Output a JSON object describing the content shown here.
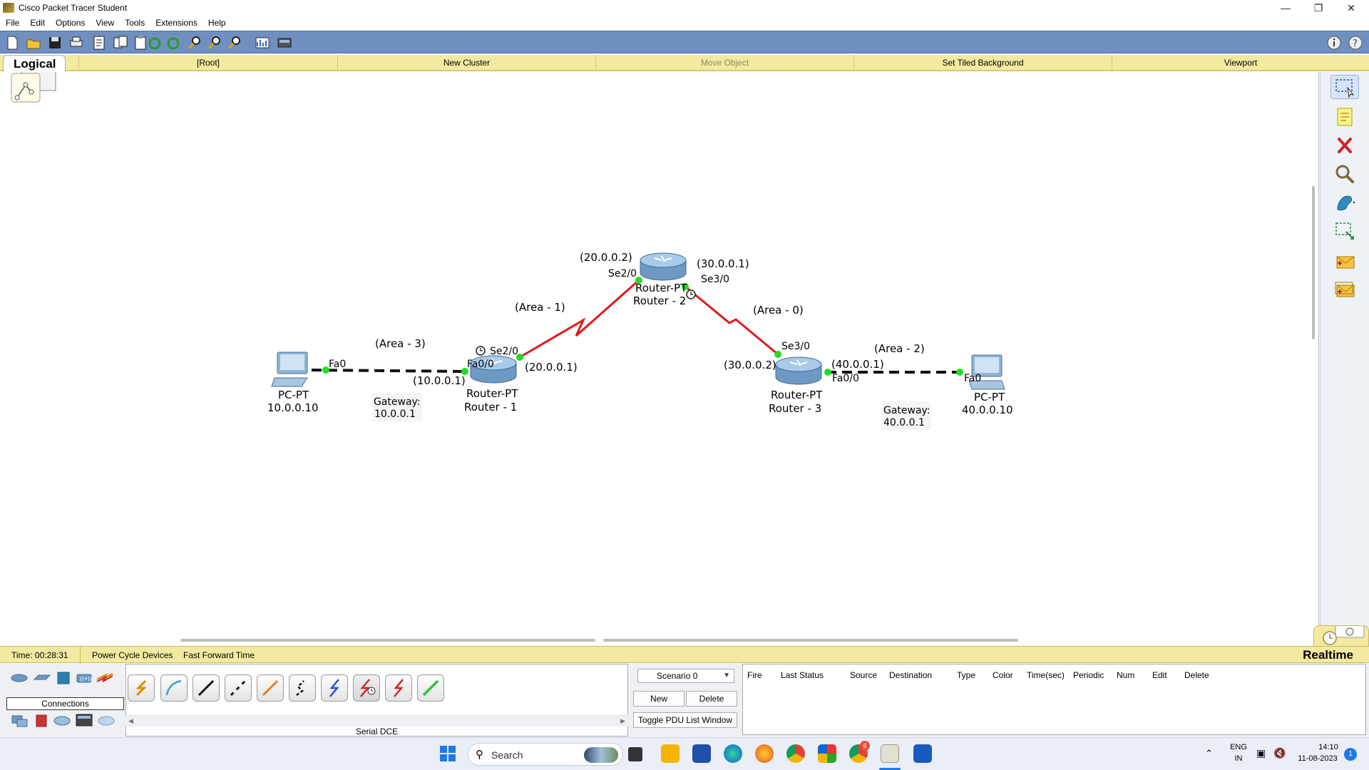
{
  "window": {
    "title": "Cisco Packet Tracer Student"
  },
  "menu": [
    "File",
    "Edit",
    "Options",
    "View",
    "Tools",
    "Extensions",
    "Help"
  ],
  "workspace": {
    "logical": "Logical",
    "root": "[Root]",
    "new_cluster": "New Cluster",
    "move_object": "Move Object",
    "set_tiled_background": "Set Tiled Background",
    "viewport": "Viewport"
  },
  "topology": {
    "pc1": {
      "type": "PC-PT",
      "name": "10.0.0.10",
      "iface": "Fa0"
    },
    "pc2": {
      "type": "PC-PT",
      "name": "40.0.0.10",
      "iface": "Fa0"
    },
    "r1": {
      "type": "Router-PT",
      "name": "Router - 1",
      "fa": "Fa0/0",
      "se": "Se2/0",
      "fa_ip": "(10.0.0.1)",
      "se_ip": "(20.0.0.1)"
    },
    "r2": {
      "type": "Router-PT",
      "name": "Router - 2",
      "se2": "Se2/0",
      "se3": "Se3/0",
      "se2_ip": "(20.0.0.2)",
      "se3_ip": "(30.0.0.1)"
    },
    "r3": {
      "type": "Router-PT",
      "name": "Router - 3",
      "se": "Se3/0",
      "fa": "Fa0/0",
      "se_ip": "(30.0.0.2)",
      "fa_ip": "(40.0.0.1)"
    },
    "area3": "(Area - 3)",
    "area1": "(Area - 1)",
    "area0": "(Area - 0)",
    "area2": "(Area - 2)",
    "gw1_label": "Gateway:",
    "gw1_value": "10.0.0.1",
    "gw2_label": "Gateway:",
    "gw2_value": "40.0.0.1"
  },
  "status": {
    "time": "Time: 00:28:31",
    "power_cycle": "Power Cycle Devices",
    "fast_forward": "Fast Forward Time",
    "mode": "Realtime"
  },
  "palette": {
    "connections_label": "Connections",
    "selected_cable": "Serial DCE",
    "cable_icons": [
      "automatic-connection-icon",
      "console-cable-icon",
      "copper-straight-through-icon",
      "copper-cross-over-icon",
      "fiber-icon",
      "phone-cable-icon",
      "coaxial-cable-icon",
      "serial-dce-icon",
      "serial-dte-icon",
      "octal-cable-icon"
    ]
  },
  "scenario": {
    "selected": "Scenario 0",
    "new": "New",
    "delete": "Delete",
    "toggle": "Toggle PDU List Window"
  },
  "pdu_columns": [
    "Fire",
    "Last Status",
    "Source",
    "Destination",
    "Type",
    "Color",
    "Time(sec)",
    "Periodic",
    "Num",
    "Edit",
    "Delete"
  ],
  "taskbar": {
    "search": "Search",
    "lang_top": "ENG",
    "lang_bottom": "IN",
    "time": "14:10",
    "date": "11-08-2023",
    "notification_count": "1",
    "chrome_badge": "6"
  },
  "colors": {
    "toolbar": "#6f8fc1",
    "workspace_bar": "#f4e9a1",
    "serial_link": "#e3171b",
    "ethernet_link": "#111111",
    "link_light": "#22dd22"
  }
}
